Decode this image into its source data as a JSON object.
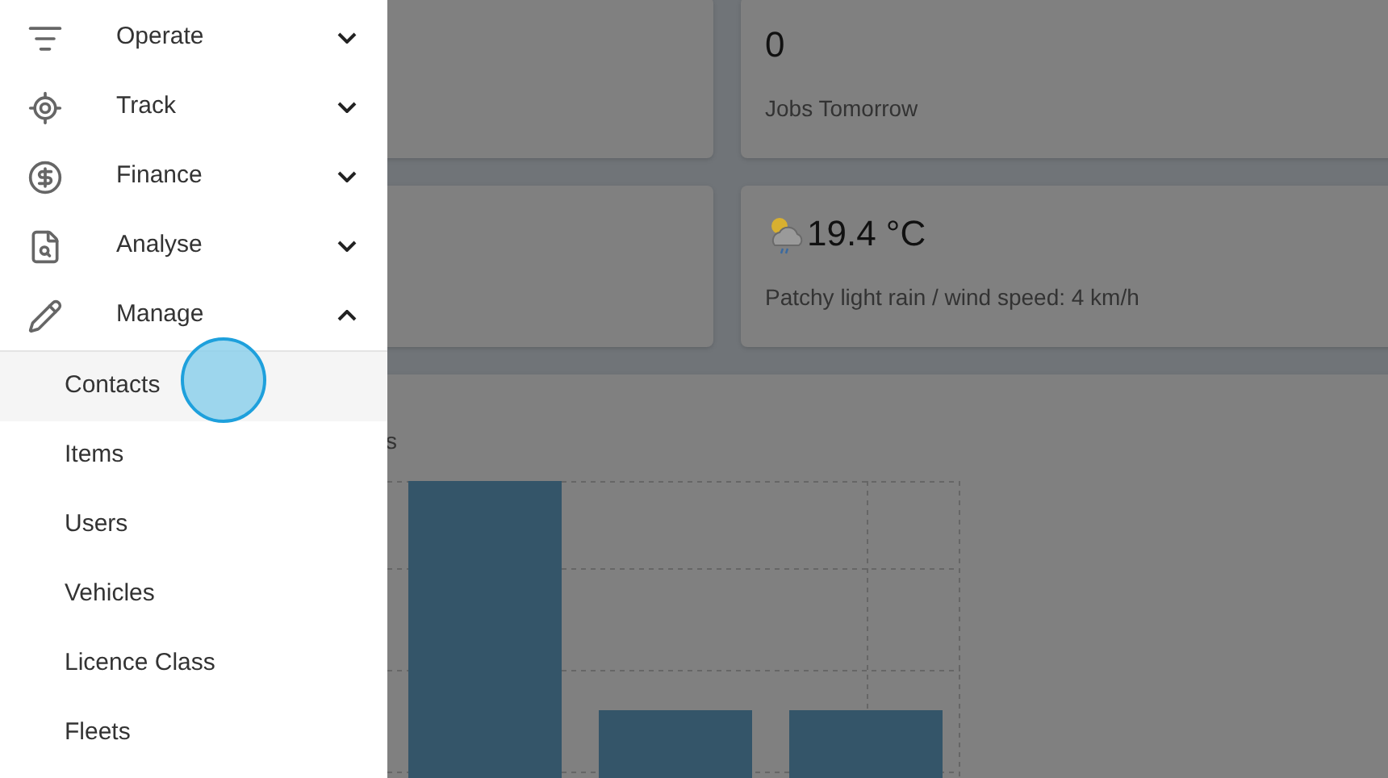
{
  "sidebar": {
    "items": [
      {
        "label": "Operate",
        "expanded": false
      },
      {
        "label": "Track",
        "expanded": false
      },
      {
        "label": "Finance",
        "expanded": false
      },
      {
        "label": "Analyse",
        "expanded": false
      },
      {
        "label": "Manage",
        "expanded": true,
        "children": [
          {
            "label": "Contacts",
            "selected": true
          },
          {
            "label": "Items",
            "selected": false
          },
          {
            "label": "Users",
            "selected": false
          },
          {
            "label": "Vehicles",
            "selected": false
          },
          {
            "label": "Licence Class",
            "selected": false
          },
          {
            "label": "Fleets",
            "selected": false
          }
        ]
      }
    ]
  },
  "dashboard": {
    "cards": [
      {
        "kind": "count",
        "value": "0",
        "label": "Jobs Tomorrow"
      },
      {
        "kind": "weather",
        "value": "19.4 °C",
        "label": "Patchy light rain / wind speed: 4 km/h"
      }
    ],
    "chart": {
      "title": "s"
    }
  }
}
